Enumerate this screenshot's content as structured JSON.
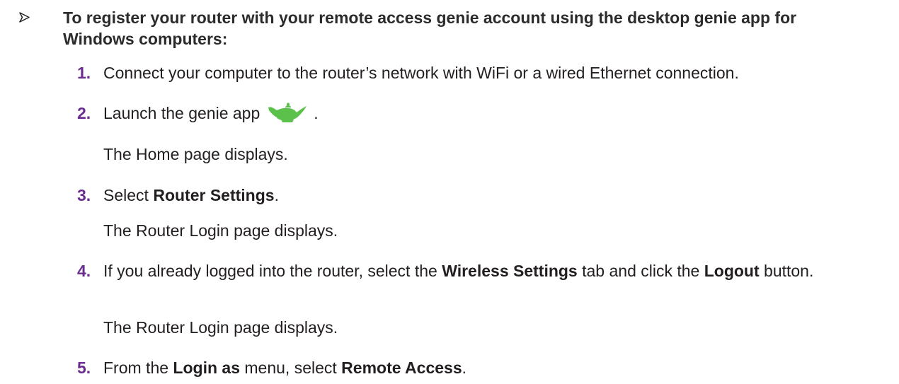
{
  "heading": {
    "text": "To register your router with your remote access genie account using the desktop genie app for Windows computers:"
  },
  "steps": [
    {
      "number": "1.",
      "parts": [
        "Connect your computer to the router’s network with WiFi or a wired Ethernet connection."
      ]
    },
    {
      "number": "2.",
      "before_icon": "Launch the genie app",
      "icon": "genie-lamp-icon",
      "after_icon": ".",
      "result": "The Home page displays."
    },
    {
      "number": "3.",
      "pre": "Select ",
      "bold": "Router Settings",
      "post": ".",
      "result": "The Router Login page displays."
    },
    {
      "number": "4.",
      "pre": "If you already logged into the router, select the ",
      "bold1": "Wireless Settings",
      "mid": " tab and click the ",
      "bold2": "Logout",
      "post": " button.",
      "result": "The Router Login page displays."
    },
    {
      "number": "5.",
      "pre": "From the ",
      "bold1": "Login as",
      "mid": " menu, select ",
      "bold2": "Remote Access",
      "post": "."
    }
  ],
  "colors": {
    "step_number": "#6a2c8e",
    "genie_lamp": "#5cc14a",
    "text": "#231f20"
  }
}
